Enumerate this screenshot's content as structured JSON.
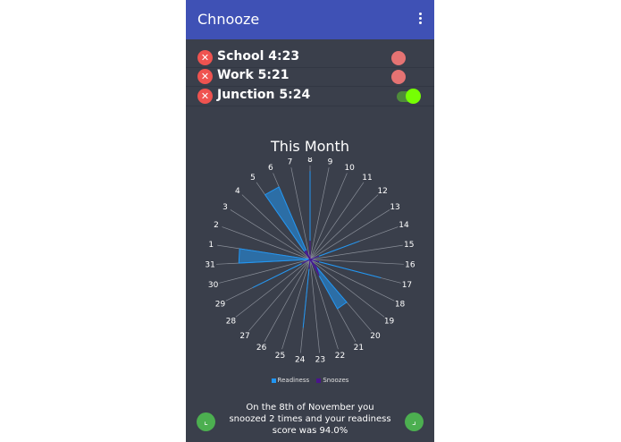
{
  "app": {
    "title": "Chnooze"
  },
  "alarms": [
    {
      "label": "School 4:23",
      "enabled": false
    },
    {
      "label": "Work 5:21",
      "enabled": false
    },
    {
      "label": "Junction 5:24",
      "enabled": true
    }
  ],
  "chart_data": {
    "type": "radar",
    "title": "This Month",
    "categories": [
      "8",
      "9",
      "10",
      "11",
      "12",
      "13",
      "14",
      "15",
      "16",
      "17",
      "18",
      "19",
      "20",
      "21",
      "22",
      "23",
      "24",
      "25",
      "26",
      "27",
      "28",
      "29",
      "30",
      "31",
      "1",
      "2",
      "3",
      "4",
      "5",
      "6",
      "7"
    ],
    "series": [
      {
        "name": "Readiness",
        "values": [
          94,
          0,
          0,
          0,
          0,
          0,
          56,
          0,
          0,
          78,
          0,
          0,
          60,
          60,
          0,
          0,
          73,
          0,
          0,
          0,
          0,
          68,
          0,
          76,
          76,
          0,
          0,
          0,
          84,
          84,
          0
        ]
      },
      {
        "name": "Snoozes",
        "values": [
          2,
          0,
          0,
          0,
          0,
          0,
          1,
          0,
          0,
          1,
          0,
          0,
          1,
          2,
          0,
          0,
          1,
          0,
          0,
          0,
          0,
          1,
          0,
          0,
          0,
          0,
          0,
          0,
          1,
          1,
          0
        ]
      }
    ],
    "legend": "bottom-center",
    "colors": {
      "readiness": "#2196f3",
      "snoozes": "#4a148c"
    }
  },
  "footer": {
    "summary_line1": "On the 8th of November you",
    "summary_line2": "snoozed 2 times and your readiness",
    "summary_line3": "score was 94.0%"
  },
  "icons": {
    "delete": "close-icon",
    "menu": "more-vert-icon",
    "prev": "corner-left-icon",
    "next": "corner-right-icon"
  }
}
